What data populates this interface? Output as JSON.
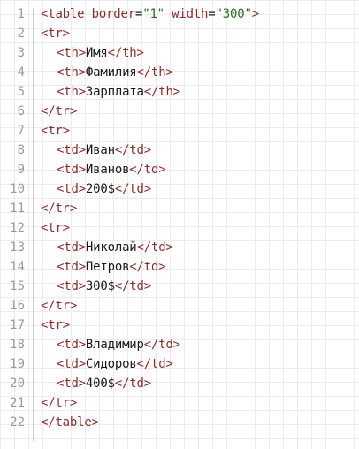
{
  "editor": {
    "lines": [
      {
        "n": "1",
        "tag_open": "<table ",
        "attr1": "border",
        "eq1": "=",
        "val1": "\"1\"",
        "sp": " ",
        "attr2": "width",
        "eq2": "=",
        "val2": "\"300\"",
        "tag_close": ">"
      },
      {
        "n": "2",
        "tag": "<tr>"
      },
      {
        "n": "3",
        "open": "<th>",
        "text": "Имя",
        "close": "</th>"
      },
      {
        "n": "4",
        "open": "<th>",
        "text": "Фамилия",
        "close": "</th>"
      },
      {
        "n": "5",
        "open": "<th>",
        "text": "Зарплата",
        "close": "</th>"
      },
      {
        "n": "6",
        "tag": "</tr>"
      },
      {
        "n": "7",
        "tag": "<tr>"
      },
      {
        "n": "8",
        "open": "<td>",
        "text": "Иван",
        "close": "</td>"
      },
      {
        "n": "9",
        "open": "<td>",
        "text": "Иванов",
        "close": "</td>"
      },
      {
        "n": "10",
        "open": "<td>",
        "text": "200$",
        "close": "</td>"
      },
      {
        "n": "11",
        "tag": "</tr>"
      },
      {
        "n": "12",
        "tag": "<tr>"
      },
      {
        "n": "13",
        "open": "<td>",
        "text": "Николай",
        "close": "</td>"
      },
      {
        "n": "14",
        "open": "<td>",
        "text": "Петров",
        "close": "</td>"
      },
      {
        "n": "15",
        "open": "<td>",
        "text": "300$",
        "close": "</td>"
      },
      {
        "n": "16",
        "tag": "</tr>"
      },
      {
        "n": "17",
        "tag": "<tr>"
      },
      {
        "n": "18",
        "open": "<td>",
        "text": "Владимир",
        "close": "</td>"
      },
      {
        "n": "19",
        "open": "<td>",
        "text": "Сидоров",
        "close": "</td>"
      },
      {
        "n": "20",
        "open": "<td>",
        "text": "400$",
        "close": "</td>"
      },
      {
        "n": "21",
        "tag": "</tr>"
      },
      {
        "n": "22",
        "tag": "</table>"
      }
    ]
  },
  "colors": {
    "tag": "#8a2c2c",
    "string": "#2d6b1e",
    "text": "#1a1a1a",
    "line_number": "#9a9a9a",
    "grid": "#ececec"
  }
}
